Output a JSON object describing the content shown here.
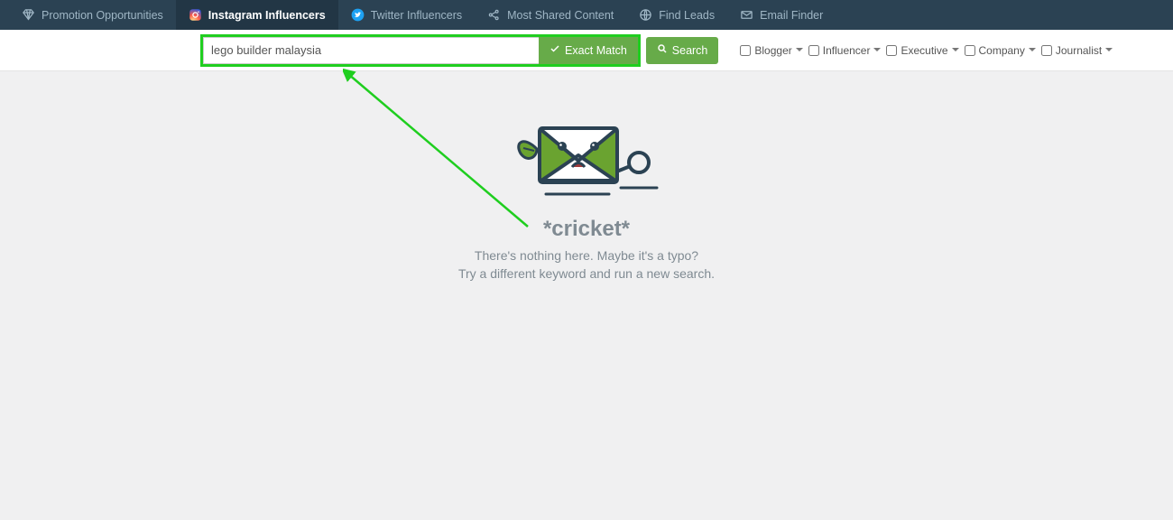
{
  "nav": {
    "tabs": [
      {
        "label": "Promotion Opportunities"
      },
      {
        "label": "Instagram Influencers"
      },
      {
        "label": "Twitter Influencers"
      },
      {
        "label": "Most Shared Content"
      },
      {
        "label": "Find Leads"
      },
      {
        "label": "Email Finder"
      }
    ],
    "active_index": 1
  },
  "search": {
    "value": "lego builder malaysia",
    "exact_match_label": "Exact Match",
    "search_label": "Search"
  },
  "filters": [
    {
      "label": "Blogger"
    },
    {
      "label": "Influencer"
    },
    {
      "label": "Executive"
    },
    {
      "label": "Company"
    },
    {
      "label": "Journalist"
    }
  ],
  "empty_state": {
    "title": "*cricket*",
    "line1": "There's nothing here. Maybe it's a typo?",
    "line2": "Try a different keyword and run a new search."
  }
}
